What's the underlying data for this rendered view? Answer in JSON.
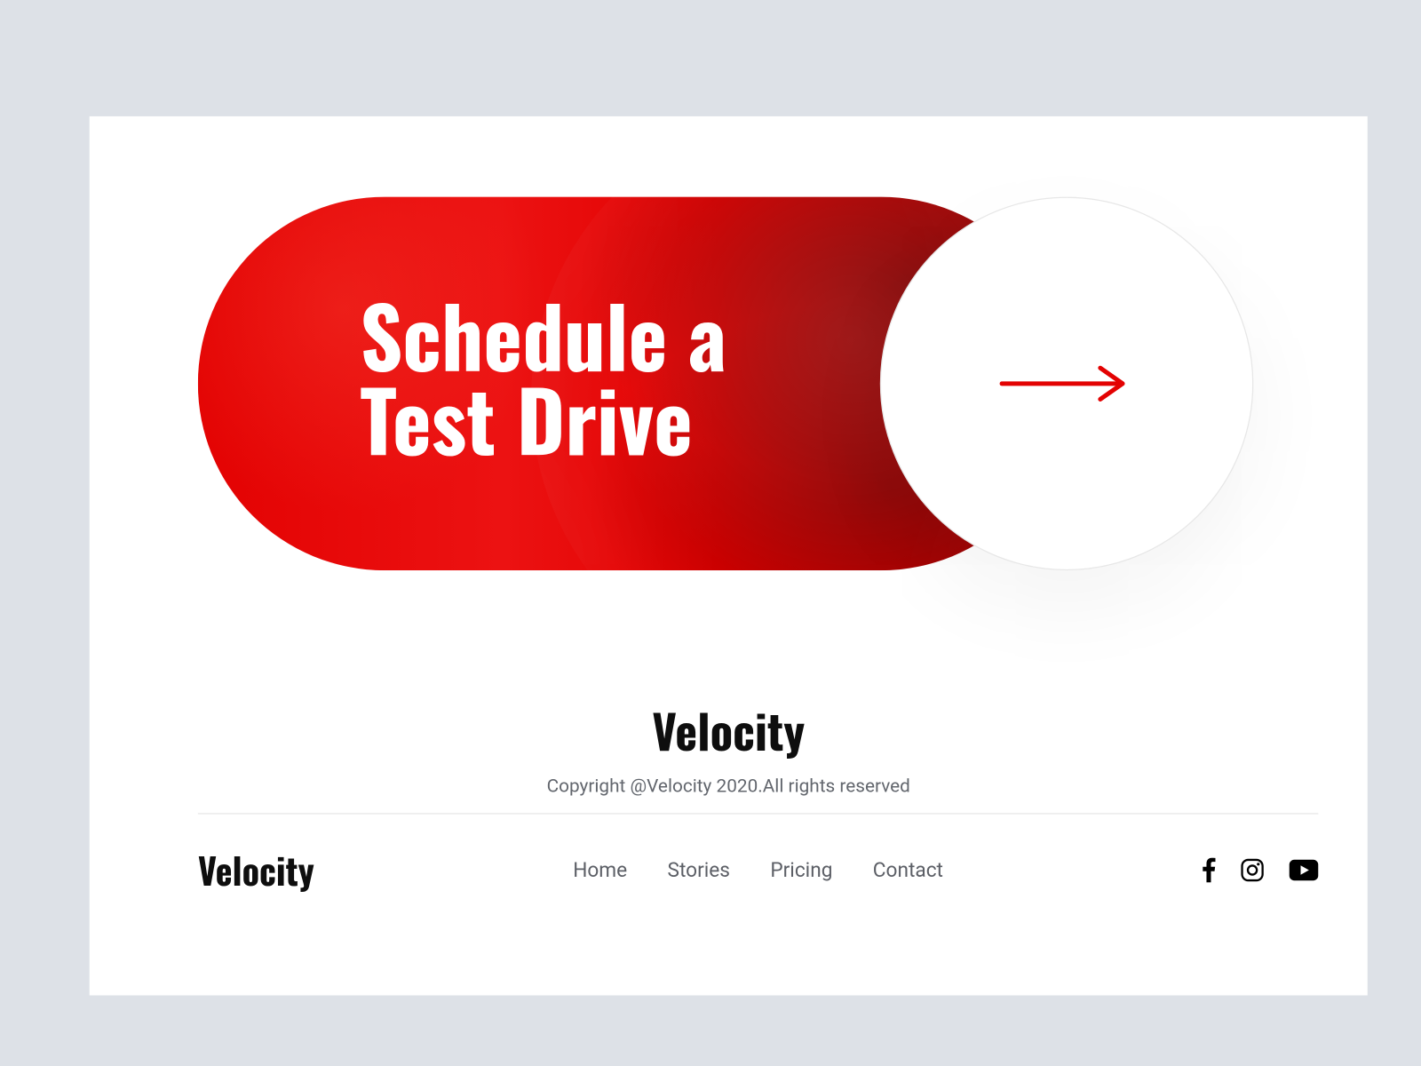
{
  "cta": {
    "label": "Schedule a\nTest Drive"
  },
  "brand": {
    "name": "Velocity",
    "copyright": "Copyright @Velocity 2020.All rights reserved"
  },
  "footer": {
    "brand": "Velocity",
    "nav": {
      "home": "Home",
      "stories": "Stories",
      "pricing": "Pricing",
      "contact": "Contact"
    }
  },
  "colors": {
    "accent": "#e30202"
  }
}
